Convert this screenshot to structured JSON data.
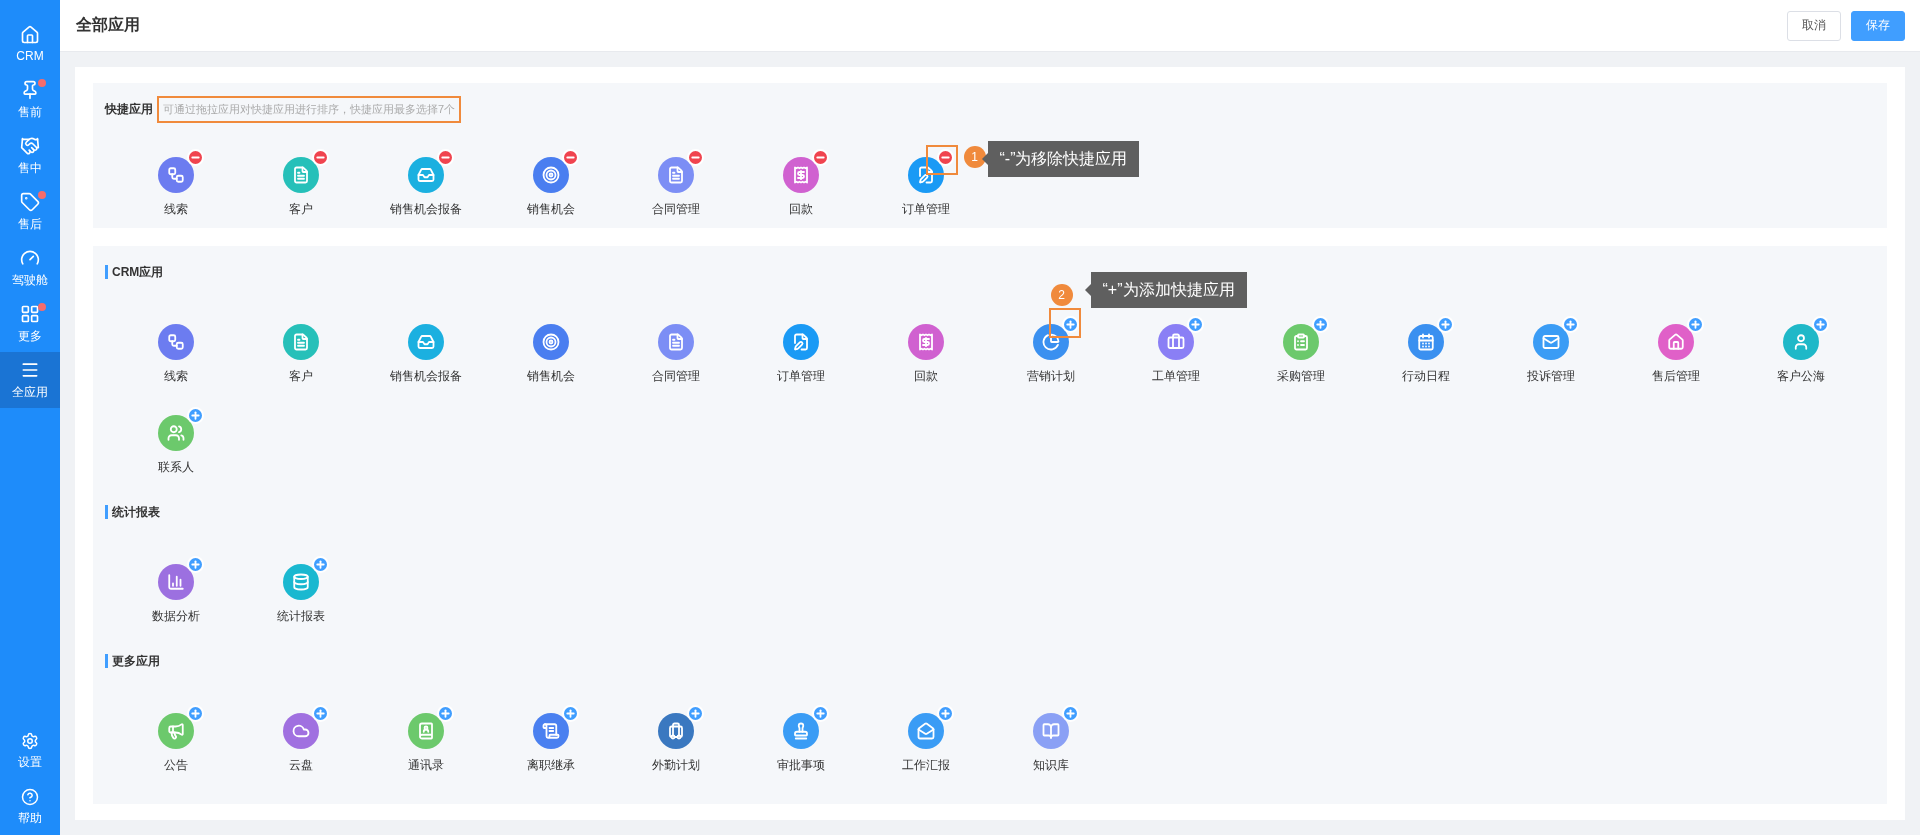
{
  "sidebar": {
    "items": [
      {
        "label": "CRM",
        "badge": false,
        "selected": false
      },
      {
        "label": "售前",
        "badge": true,
        "selected": false
      },
      {
        "label": "售中",
        "badge": false,
        "selected": false
      },
      {
        "label": "售后",
        "badge": true,
        "selected": false
      },
      {
        "label": "驾驶舱",
        "badge": false,
        "selected": false
      },
      {
        "label": "更多",
        "badge": true,
        "selected": false
      },
      {
        "label": "全应用",
        "badge": false,
        "selected": true
      }
    ],
    "bottom_items": [
      {
        "label": "设置"
      },
      {
        "label": "帮助"
      }
    ]
  },
  "header": {
    "title": "全部应用",
    "buttons": [
      {
        "label": "取消",
        "kind": "default"
      },
      {
        "label": "保存",
        "kind": "primary"
      }
    ]
  },
  "sections": [
    {
      "title": "快捷应用",
      "kind": "quick",
      "hint": {
        "text": "可通过拖拉应用对快捷应用进行排序，快捷应用最多选择7个",
        "highlighted": true
      },
      "apps": [
        {
          "label": "线索",
          "color": "#6c7cf0",
          "kind": "remove"
        },
        {
          "label": "客户",
          "color": "#26c0b9",
          "kind": "remove"
        },
        {
          "label": "销售机会报备",
          "color": "#1bb0e0",
          "kind": "remove"
        },
        {
          "label": "销售机会",
          "color": "#4a7ef0",
          "kind": "remove"
        },
        {
          "label": "合同管理",
          "color": "#7c8ef5",
          "kind": "remove"
        },
        {
          "label": "回款",
          "color": "#d061d0",
          "kind": "remove"
        },
        {
          "label": "订单管理",
          "color": "#1a9af5",
          "kind": "remove",
          "callout": {
            "number": "1",
            "text": "“-”为移除快捷应用",
            "kind": "right"
          }
        }
      ]
    },
    {
      "title": "CRM应用",
      "kind": "group",
      "apps": [
        {
          "label": "线索",
          "color": "#6c7cf0",
          "kind": "plain"
        },
        {
          "label": "客户",
          "color": "#26c0b9",
          "kind": "plain"
        },
        {
          "label": "销售机会报备",
          "color": "#1bb0e0",
          "kind": "plain"
        },
        {
          "label": "销售机会",
          "color": "#4a7ef0",
          "kind": "plain"
        },
        {
          "label": "合同管理",
          "color": "#7c8ef5",
          "kind": "plain"
        },
        {
          "label": "订单管理",
          "color": "#1a9af5",
          "kind": "plain"
        },
        {
          "label": "回款",
          "color": "#d061d0",
          "kind": "plain"
        },
        {
          "label": "营销计划",
          "color": "#3a90f0",
          "kind": "add",
          "callout": {
            "number": "2",
            "text": "“+”为添加快捷应用",
            "kind": "top"
          }
        },
        {
          "label": "工单管理",
          "color": "#8a7ff5",
          "kind": "add"
        },
        {
          "label": "采购管理",
          "color": "#6cc96c",
          "kind": "add"
        },
        {
          "label": "行动日程",
          "color": "#3a90f0",
          "kind": "add"
        },
        {
          "label": "投诉管理",
          "color": "#3a9cf5",
          "kind": "add"
        },
        {
          "label": "售后管理",
          "color": "#e060c8",
          "kind": "add"
        },
        {
          "label": "客户公海",
          "color": "#1fb8c8",
          "kind": "add"
        },
        {
          "label": "联系人",
          "color": "#6cc96c",
          "kind": "add"
        }
      ]
    },
    {
      "title": "统计报表",
      "kind": "group",
      "apps": [
        {
          "label": "数据分析",
          "color": "#9c70e0",
          "kind": "add"
        },
        {
          "label": "统计报表",
          "color": "#1ab8d0",
          "kind": "add"
        }
      ]
    },
    {
      "title": "更多应用",
      "kind": "group",
      "apps": [
        {
          "label": "公告",
          "color": "#6cc96c",
          "kind": "add"
        },
        {
          "label": "云盘",
          "color": "#a070e0",
          "kind": "add"
        },
        {
          "label": "通讯录",
          "color": "#6cc96c",
          "kind": "add"
        },
        {
          "label": "离职继承",
          "color": "#4a80f0",
          "kind": "add"
        },
        {
          "label": "外勤计划",
          "color": "#3a78c0",
          "kind": "add"
        },
        {
          "label": "审批事项",
          "color": "#3a9cf5",
          "kind": "add"
        },
        {
          "label": "工作汇报",
          "color": "#3a9cf5",
          "kind": "add"
        },
        {
          "label": "知识库",
          "color": "#8aa0f5",
          "kind": "add"
        }
      ]
    }
  ]
}
